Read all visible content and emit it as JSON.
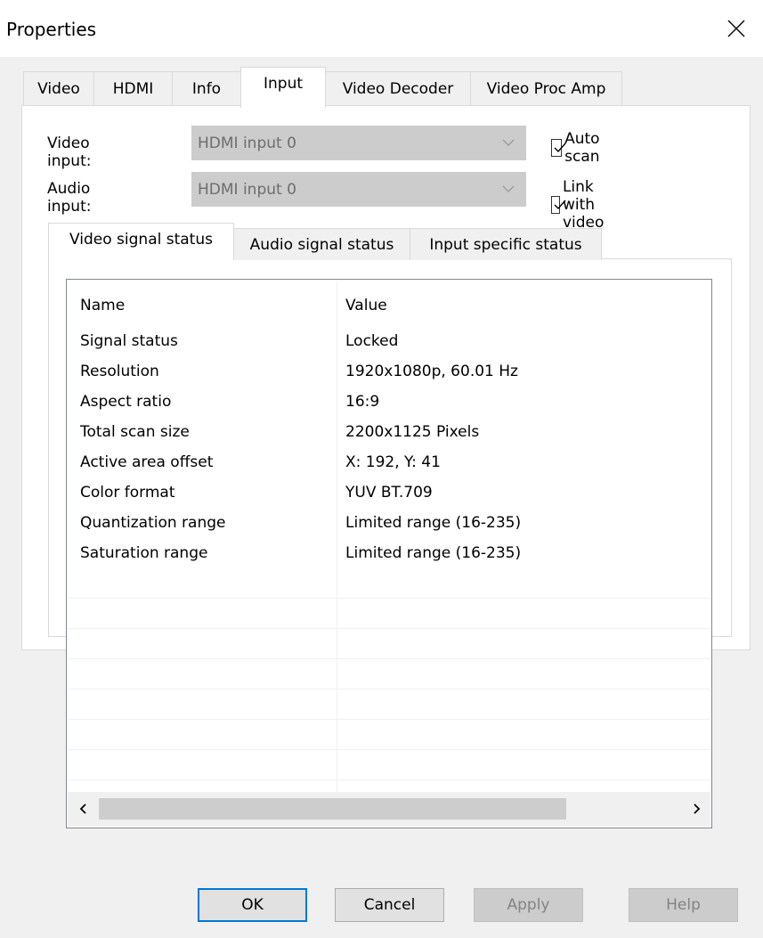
{
  "window": {
    "title": "Properties"
  },
  "tabs": [
    {
      "label": "Video",
      "active": false
    },
    {
      "label": "HDMI",
      "active": false
    },
    {
      "label": "Info",
      "active": false
    },
    {
      "label": "Input",
      "active": true
    },
    {
      "label": "Video Decoder",
      "active": false
    },
    {
      "label": "Video Proc Amp",
      "active": false
    }
  ],
  "input": {
    "video_input_label": "Video input:",
    "video_input_value": "HDMI input 0",
    "audio_input_label": "Audio input:",
    "audio_input_value": "HDMI input 0",
    "auto_scan": {
      "label": "Auto scan",
      "checked": true
    },
    "link_with_video": {
      "label": "Link with video",
      "checked": true
    }
  },
  "status_tabs": [
    {
      "label": "Video signal status",
      "active": true
    },
    {
      "label": "Audio signal status",
      "active": false
    },
    {
      "label": "Input specific status",
      "active": false
    }
  ],
  "table": {
    "columns": [
      "Name",
      "Value"
    ],
    "rows": [
      [
        "Signal status",
        "Locked"
      ],
      [
        "Resolution",
        "1920x1080p, 60.01 Hz"
      ],
      [
        "Aspect ratio",
        "16:9"
      ],
      [
        "Total scan size",
        "2200x1125 Pixels"
      ],
      [
        "Active area offset",
        "X: 192, Y: 41"
      ],
      [
        "Color format",
        "YUV BT.709"
      ],
      [
        "Quantization range",
        "Limited range (16-235)"
      ],
      [
        "Saturation range",
        "Limited range (16-235)"
      ]
    ]
  },
  "buttons": {
    "ok": "OK",
    "cancel": "Cancel",
    "apply": "Apply",
    "help": "Help"
  },
  "icons": {
    "close": "close-icon",
    "dropdown": "chevron-down-icon",
    "check": "checkmark-icon",
    "scroll_left": "chevron-left-icon",
    "scroll_right": "chevron-right-icon"
  },
  "colors": {
    "accent": "#0078d7"
  }
}
